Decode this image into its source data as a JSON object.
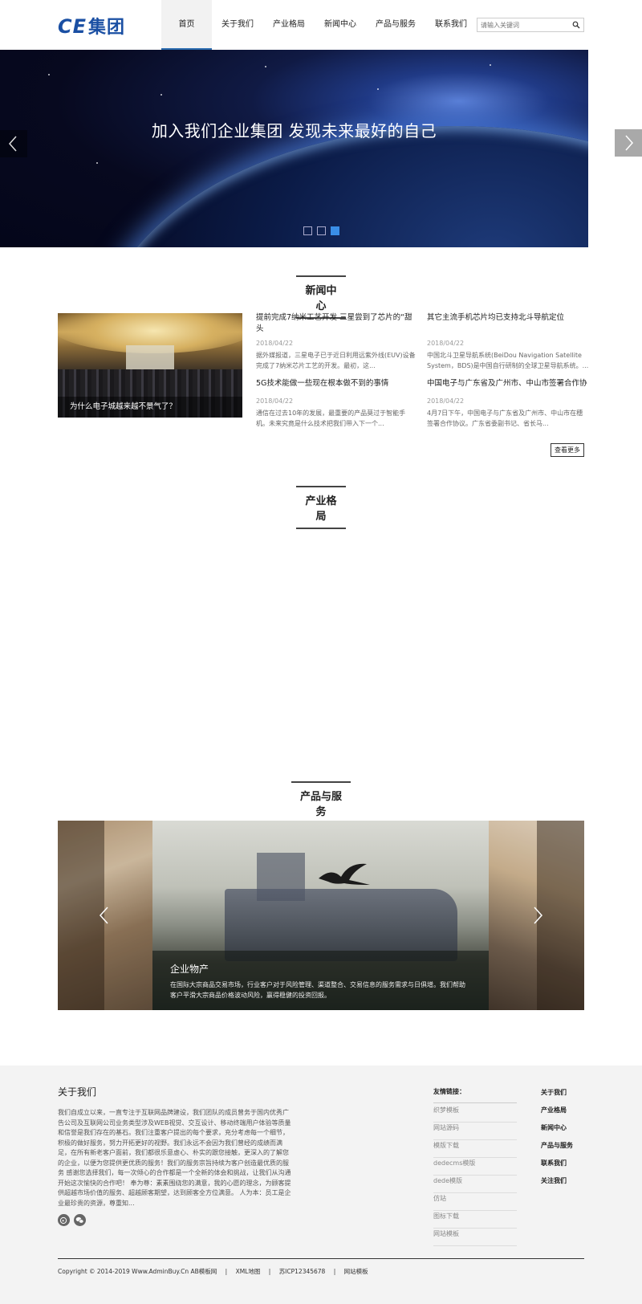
{
  "header": {
    "logo_text": "CE",
    "logo_suffix": "集团",
    "nav": [
      "首页",
      "关于我们",
      "产业格局",
      "新闻中心",
      "产品与服务",
      "联系我们"
    ],
    "search_placeholder": "请输入关键词",
    "search_icon": "search-icon"
  },
  "banner": {
    "title": "加入我们企业集团 发现未来最好的自己",
    "slides": 3,
    "active_slide": 3
  },
  "news": {
    "section_title": "新闻中心",
    "featured_caption": "为什么电子城越来越不景气了？",
    "items": [
      {
        "title": "提前完成7纳米工艺开发 三星尝到了芯片的“甜头",
        "date": "2018/04/22",
        "summary": "据外媒报道，三星电子已于近日利用远紫外线(EUV)设备完成了7纳米芯片工艺的开发。最初，这..."
      },
      {
        "title": "其它主流手机芯片均已支持北斗导航定位",
        "date": "2018/04/22",
        "summary": "中国北斗卫星导航系统(BeiDou Navigation Satellite System，BDS)是中国自行研制的全球卫星导航系统。..."
      },
      {
        "title": "5G技术能做一些现在根本做不到的事情",
        "date": "2018/04/22",
        "summary": "通信在过去10年的发展，最重要的产品莫过于智能手机。未来究竟是什么技术把我们带入下一个..."
      },
      {
        "title": "中国电子与广东省及广州市、中山市签署合作协",
        "date": "2018/04/22",
        "summary": "4月7日下午，中国电子与广东省及广州市、中山市在穗签署合作协议。广东省委副书记、省长马..."
      }
    ],
    "more_label": "查看更多"
  },
  "industry": {
    "section_title": "产业格局"
  },
  "products": {
    "section_title": "产品与服务",
    "slide_title": "企业物产",
    "slide_desc": "在国际大宗商品交易市场，行业客户对于风险管理、渠道整合、交易信息的服务需求与日俱增。我们帮助客户平滑大宗商品价格波动风险，赢得稳健的投资回报。"
  },
  "footer": {
    "about_title": "关于我们",
    "about_text": "我们自成立以来，一直专注于互联网品牌建设，我们团队的成员曾务于国内优秀广告公司及互联网公司业务类型涉及WEB视觉、交互设计、移动终端用户体验等质量和信誉是我们存在的基石。我们注重客户提出的每个要求，充分考虑每一个细节，积极的做好服务，努力开拓更好的视野。我们永远不会因为我们曾经的成绩而满足，在所有新老客户面前，我们都很乐意虚心、朴实的跟您接触，更深入的了解您的企业，以便为您提供更优质的服务！我们的服务宗旨持续为客户创造最优质的服务 感谢您选择我们，每一次倾心的合作都是一个全新的体会和挑战，让我们从沟通开始这次愉快的合作吧！ 奉为尊：素素围绕您的满意，我的心愿的理念，为顾客提供超越市场价值的服务、超越顾客期望，达到顾客全方位满意。 人为本：员工是企业最珍贵的资源，尊重知...",
    "links_title": "友情链接：",
    "links": [
      "织梦模板",
      "网站源码",
      "模版下载",
      "dedecms模版",
      "dede模版",
      "仿站",
      "图标下载",
      "网站模板"
    ],
    "nav": [
      "关于我们",
      "产业格局",
      "新闻中心",
      "产品与服务",
      "联系我们",
      "关注我们"
    ],
    "copyright": "Copyright © 2014-2019 Www.AdminBuy.Cn AB模板网",
    "copy_links": [
      "XML地图",
      "苏ICP12345678",
      "网站模板"
    ]
  }
}
